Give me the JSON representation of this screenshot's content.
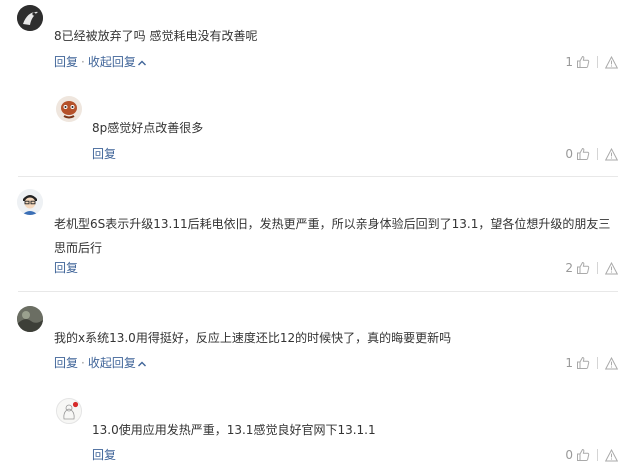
{
  "labels": {
    "reply": "回复",
    "separator": "·",
    "collapse": "收起回复"
  },
  "icons": {
    "like": "thumbs-up-icon",
    "report": "warning-icon",
    "collapse": "chevron-up-icon"
  },
  "colors": {
    "link": "#406599",
    "muted": "#999999",
    "text": "#333333",
    "divider": "#e8e8e8"
  },
  "comments": [
    {
      "text": "8已经被放弃了吗 感觉耗电没有改善呢",
      "likes": "1",
      "reply": {
        "text": "8p感觉好点改善很多",
        "likes": "0"
      }
    },
    {
      "text": "老机型6S表示升级13.11后耗电依旧，发热更严重，所以亲身体验后回到了13.1，望各位想升级的朋友三思而后行",
      "likes": "2"
    },
    {
      "text": "我的x系统13.0用得挺好，反应上速度还比12的时候快了，真的晦要更新吗",
      "likes": "1",
      "reply": {
        "text": "13.0使用应用发热严重，13.1感觉良好官网下13.1.1",
        "likes": "0"
      }
    }
  ]
}
